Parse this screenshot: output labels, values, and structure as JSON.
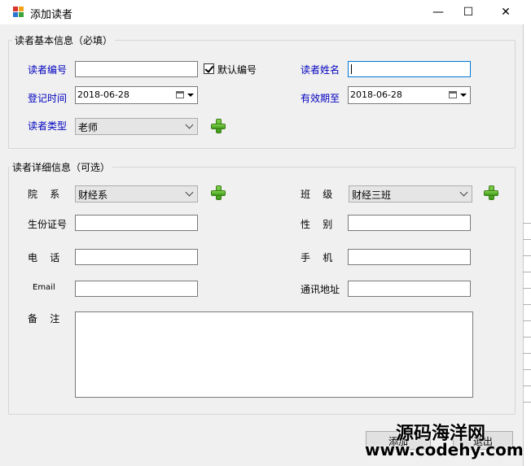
{
  "window": {
    "title": "添加读者"
  },
  "basic": {
    "group_title": "读者基本信息（必填）",
    "reader_no_label": "读者编号",
    "reader_no_value": "",
    "default_no_label": "默认编号",
    "default_no_checked": true,
    "reader_name_label": "读者姓名",
    "reader_name_value": "",
    "register_time_label": "登记时间",
    "register_time_value": "2018-06-28",
    "valid_until_label": "有效期至",
    "valid_until_value": "2018-06-28",
    "reader_type_label": "读者类型",
    "reader_type_value": "老师"
  },
  "detail": {
    "group_title": "读者详细信息（可选）",
    "dept_label": "院    系",
    "dept_value": "财经系",
    "class_label": "班    级",
    "class_value": "财经三班",
    "id_label": "生份证号",
    "gender_label": "性    别",
    "phone_label": "电    话",
    "mobile_label": "手    机",
    "email_label": "Email",
    "address_label": "通讯地址",
    "note_label": "备    注"
  },
  "buttons": {
    "add": "添加",
    "exit": "退出"
  },
  "watermark": {
    "line1": "源码海洋网",
    "line2": "www.codehy.com"
  },
  "colors": {
    "label_blue": "#0000c0",
    "plus_green": "#4caf2a"
  }
}
